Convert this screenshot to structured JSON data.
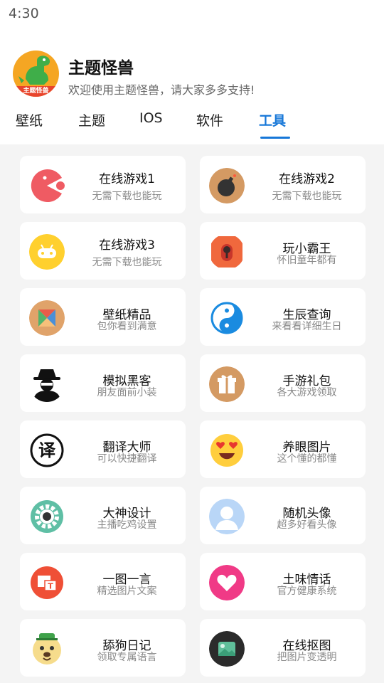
{
  "status": {
    "time": "4:30"
  },
  "header": {
    "app_name": "主题怪兽",
    "subtitle": "欢迎使用主题怪兽，请大家多多支持!",
    "logo_text": "主题怪兽"
  },
  "tabs": [
    {
      "label": "壁纸"
    },
    {
      "label": "主题"
    },
    {
      "label": "IOS"
    },
    {
      "label": "软件"
    },
    {
      "label": "工具",
      "active": true
    }
  ],
  "cards": [
    {
      "title": "在线游戏1",
      "subtitle": "无需下载也能玩",
      "icon": "pacman-icon"
    },
    {
      "title": "在线游戏2",
      "subtitle": "无需下载也能玩",
      "icon": "bomb-icon"
    },
    {
      "title": "在线游戏3",
      "subtitle": "无需下载也能玩",
      "icon": "gamepad-icon"
    },
    {
      "title": "玩小霸王",
      "subtitle": "怀旧童年都有",
      "icon": "joystick-icon"
    },
    {
      "title": "壁纸精品",
      "subtitle": "包你看到满意",
      "icon": "tangram-icon"
    },
    {
      "title": "生辰查询",
      "subtitle": "来看看详细生日",
      "icon": "yin-yang-icon"
    },
    {
      "title": "模拟黑客",
      "subtitle": "朋友面前小装",
      "icon": "hacker-icon"
    },
    {
      "title": "手游礼包",
      "subtitle": "各大游戏领取",
      "icon": "gift-icon"
    },
    {
      "title": "翻译大师",
      "subtitle": "可以快捷翻译",
      "icon": "translate-icon",
      "icon_text": "译"
    },
    {
      "title": "养眼图片",
      "subtitle": "这个懂的都懂",
      "icon": "heart-eyes-emoji-icon"
    },
    {
      "title": "大神设计",
      "subtitle": "主播吃鸡设置",
      "icon": "settings-gear-icon"
    },
    {
      "title": "随机头像",
      "subtitle": "超多好看头像",
      "icon": "avatar-silhouette-icon"
    },
    {
      "title": "一图一言",
      "subtitle": "精选图片文案",
      "icon": "image-text-icon"
    },
    {
      "title": "土味情话",
      "subtitle": "官方健康系统",
      "icon": "heart-icon"
    },
    {
      "title": "舔狗日记",
      "subtitle": "领取专属语言",
      "icon": "dog-face-icon"
    },
    {
      "title": "在线抠图",
      "subtitle": "把图片变透明",
      "icon": "picture-icon"
    }
  ]
}
